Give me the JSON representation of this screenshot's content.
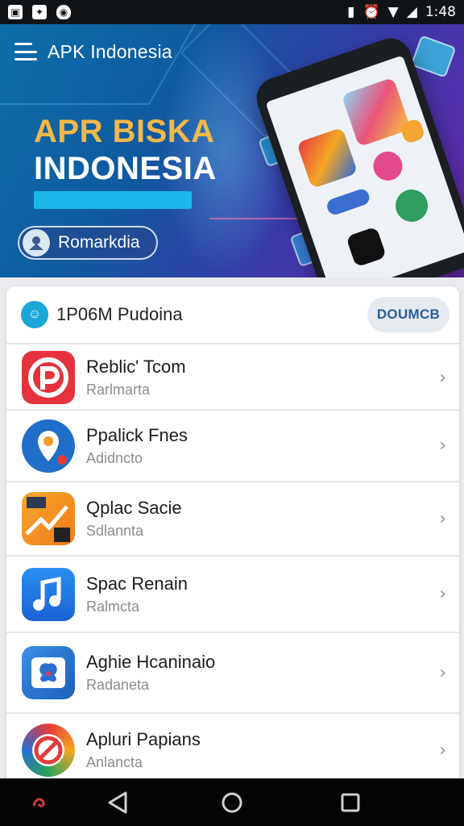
{
  "status_bar": {
    "time": "1:48",
    "left_icons": [
      "notification-icon",
      "app-icon",
      "shield-icon"
    ],
    "right_icons": [
      "sim-icon",
      "alarm-icon",
      "wifi-icon",
      "signal-icon"
    ]
  },
  "app_bar": {
    "title": "APK Indonesia"
  },
  "hero": {
    "title_line1": "APR BISKA",
    "title_line2": "INDONESIA",
    "chip_label": "Romarkdia"
  },
  "section": {
    "title": "1P06M Pudoina",
    "button_label": "DOUMCB"
  },
  "apps": [
    {
      "name": "Reblic' Tcom",
      "subtitle": "Rarlmarta",
      "icon": "app-icon-red-p"
    },
    {
      "name": "Ppalick Fnes",
      "subtitle": "Adidncto",
      "icon": "app-icon-blue-pin"
    },
    {
      "name": "Qplac Sacie",
      "subtitle": "Sdlannta",
      "icon": "app-icon-orange-chart"
    },
    {
      "name": "Spac Renain",
      "subtitle": "Ralmcta",
      "icon": "music-note-icon"
    },
    {
      "name": "Aghie Hcaninaio",
      "subtitle": "Radaneta",
      "icon": "app-icon-butterfly"
    },
    {
      "name": "Apluri Papians",
      "subtitle": "Anlancta",
      "icon": "app-icon-no-symbol"
    }
  ],
  "colors": {
    "accent": "#1aa7d8",
    "button_text": "#2a5f97"
  }
}
